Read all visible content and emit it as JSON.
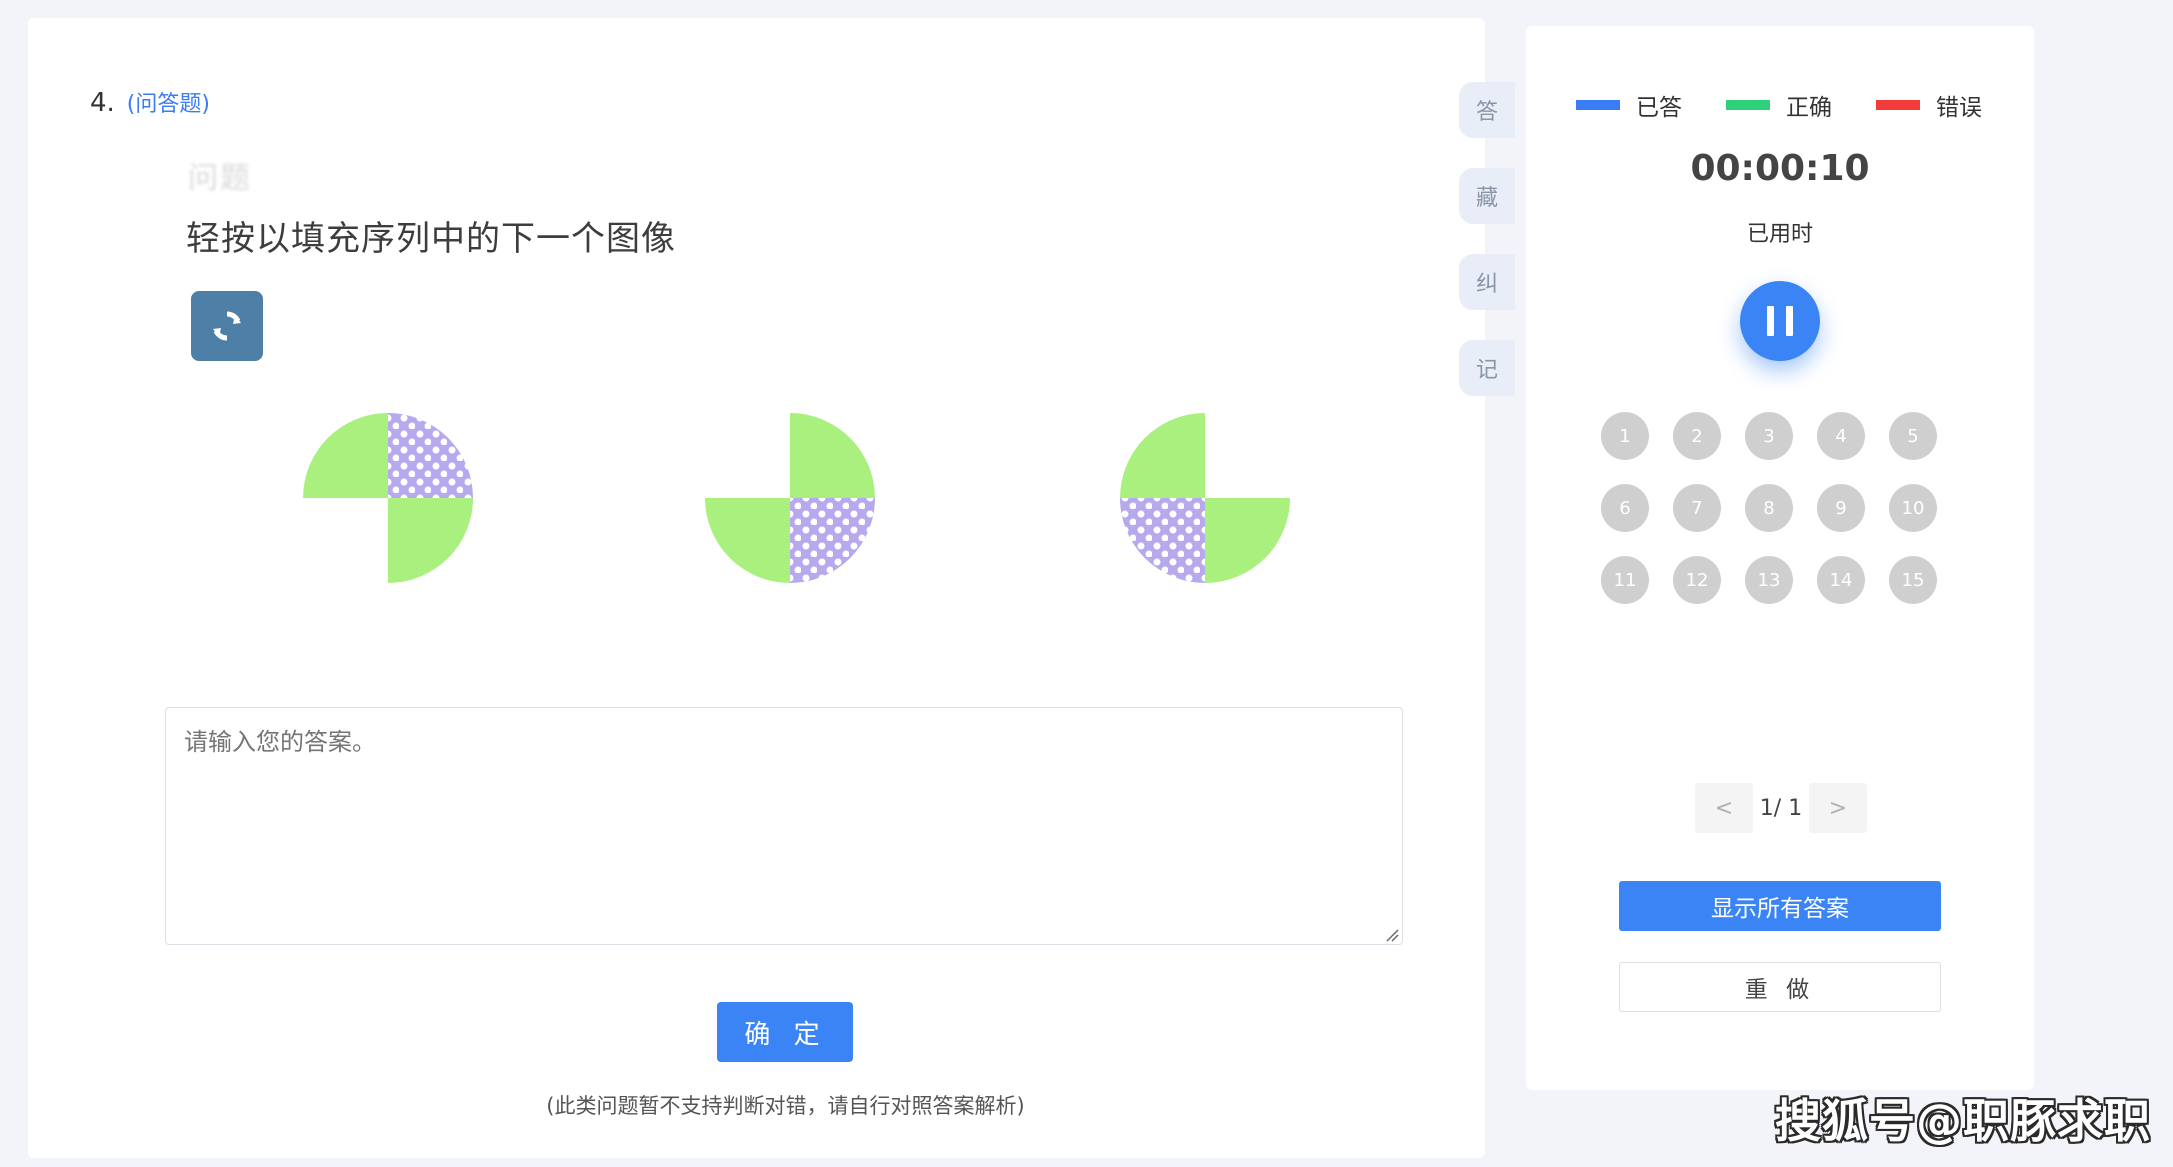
{
  "question": {
    "number": "4.",
    "type_label": "(问答题)",
    "blurred_header": "问题",
    "prompt": "轻按以填充序列中的下一个图像",
    "refresh_icon": "refresh-icon",
    "colors": {
      "green": "#a9f07f",
      "purple": "#b6a9ee",
      "dot": "#ffffff"
    }
  },
  "answer": {
    "placeholder": "请输入您的答案。",
    "confirm_label": "确 定",
    "note": "(此类问题暂不支持判断对错，请自行对照答案解析)"
  },
  "side_tabs": [
    "答",
    "藏",
    "纠",
    "记"
  ],
  "panel": {
    "legend": [
      {
        "label": "已答",
        "color": "#3a7bf6"
      },
      {
        "label": "正确",
        "color": "#2fd07a"
      },
      {
        "label": "错误",
        "color": "#f23c3c"
      }
    ],
    "timer": "00:00:10",
    "timer_label": "已用时",
    "pause_icon": "pause-icon",
    "numbers": [
      "1",
      "2",
      "3",
      "4",
      "5",
      "6",
      "7",
      "8",
      "9",
      "10",
      "11",
      "12",
      "13",
      "14",
      "15"
    ],
    "pager": {
      "prev": "<",
      "page": "1/ 1",
      "next": ">"
    },
    "show_answers_label": "显示所有答案",
    "redo_label": "重 做"
  },
  "watermark": "搜狐号@职豚求职"
}
